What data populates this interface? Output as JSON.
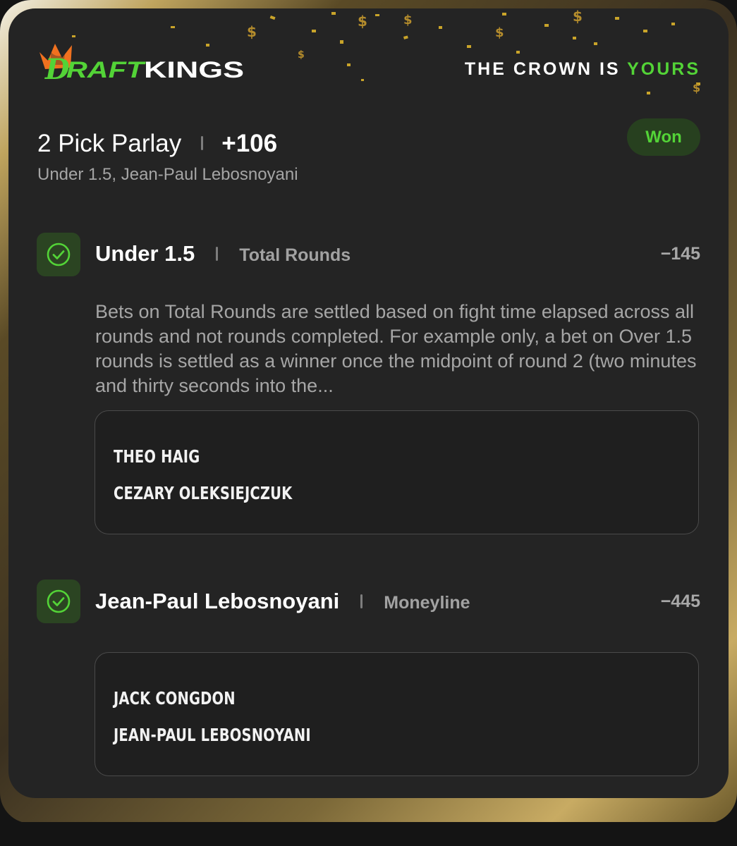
{
  "header": {
    "logo_text": "DRAFTKINGS",
    "slogan_prefix": "THE CROWN IS",
    "slogan_highlight": "YOURS",
    "accent_color": "#53d337",
    "logo_orange": "#f0711f"
  },
  "parlay": {
    "title": "2 Pick Parlay",
    "odds": "+106",
    "subtitle": "Under 1.5, Jean-Paul Lebosnoyani",
    "status": "Won"
  },
  "legs": [
    {
      "icon": "check-circle-icon",
      "selection": "Under 1.5",
      "market": "Total Rounds",
      "odds": "−145",
      "rule_text": "Bets on Total Rounds are settled based on fight time elapsed across all rounds and not rounds completed. For example only, a bet on Over 1.5 rounds is settled as a winner once the midpoint of round 2 (two minutes and thirty seconds into the...",
      "fighters": [
        "THEO HAIG",
        "CEZARY OLEKSIEJCZUK"
      ]
    },
    {
      "icon": "check-circle-icon",
      "selection": "Jean-Paul Lebosnoyani",
      "market": "Moneyline",
      "odds": "−445",
      "fighters": [
        "JACK CONGDON",
        "JEAN-PAUL LEBOSNOYANI"
      ]
    }
  ]
}
